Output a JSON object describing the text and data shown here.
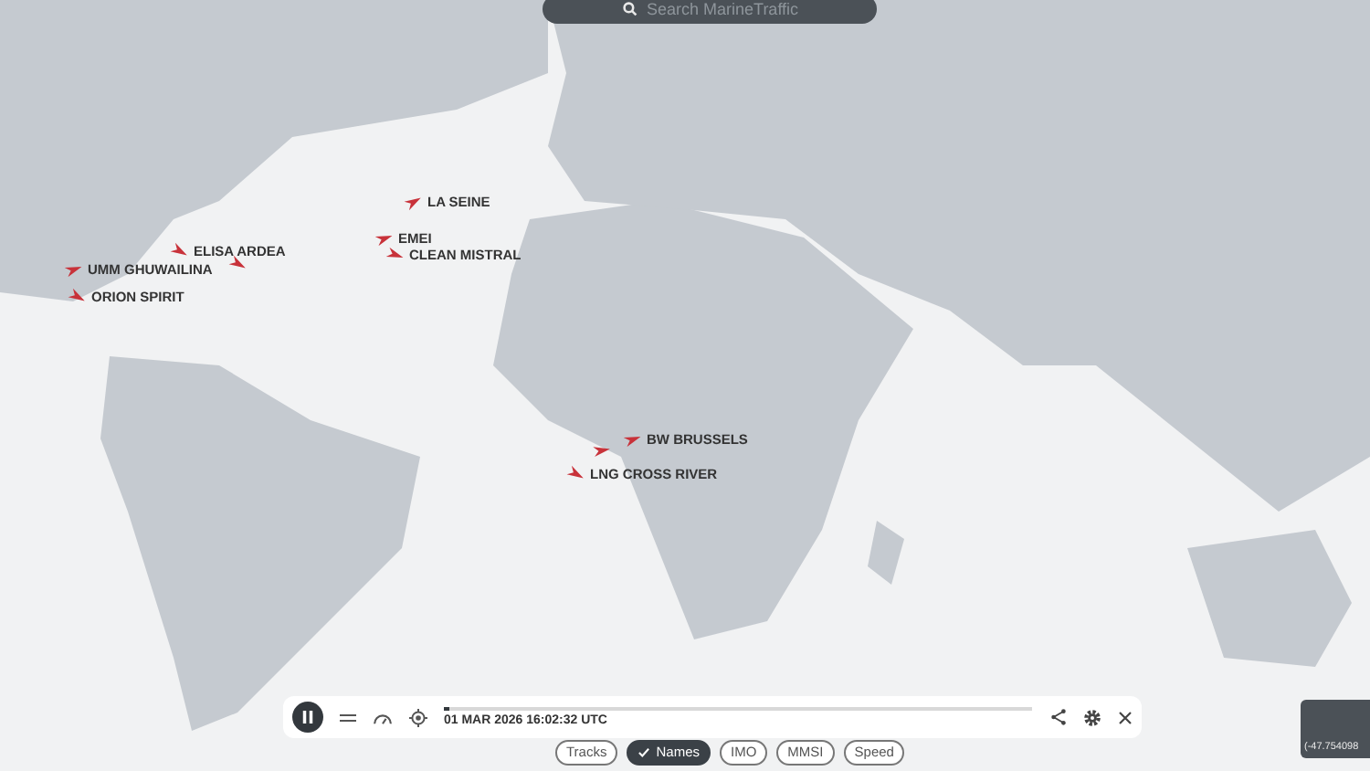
{
  "search": {
    "placeholder": "Search MarineTraffic"
  },
  "vessels": [
    {
      "name": "LA SEINE"
    },
    {
      "name": "ELISA ARDEA"
    },
    {
      "name": "EMEI"
    },
    {
      "name": "CLEAN MISTRAL"
    },
    {
      "name": "UMM GHUWAILINA"
    },
    {
      "name": "ORION SPIRIT"
    },
    {
      "name": "BW BRUSSELS"
    },
    {
      "name": "LNG CROSS RIVER"
    }
  ],
  "playback": {
    "playing": true,
    "timestamp": "01 MAR 2026 16:02:32 UTC",
    "level": 0.01
  },
  "chips": [
    {
      "label": "Tracks",
      "selected": false
    },
    {
      "label": "Names",
      "selected": true
    },
    {
      "label": "IMO",
      "selected": false
    },
    {
      "label": "MMSI",
      "selected": false
    },
    {
      "label": "Speed",
      "selected": false
    }
  ],
  "coordinates": "(-47.754098"
}
